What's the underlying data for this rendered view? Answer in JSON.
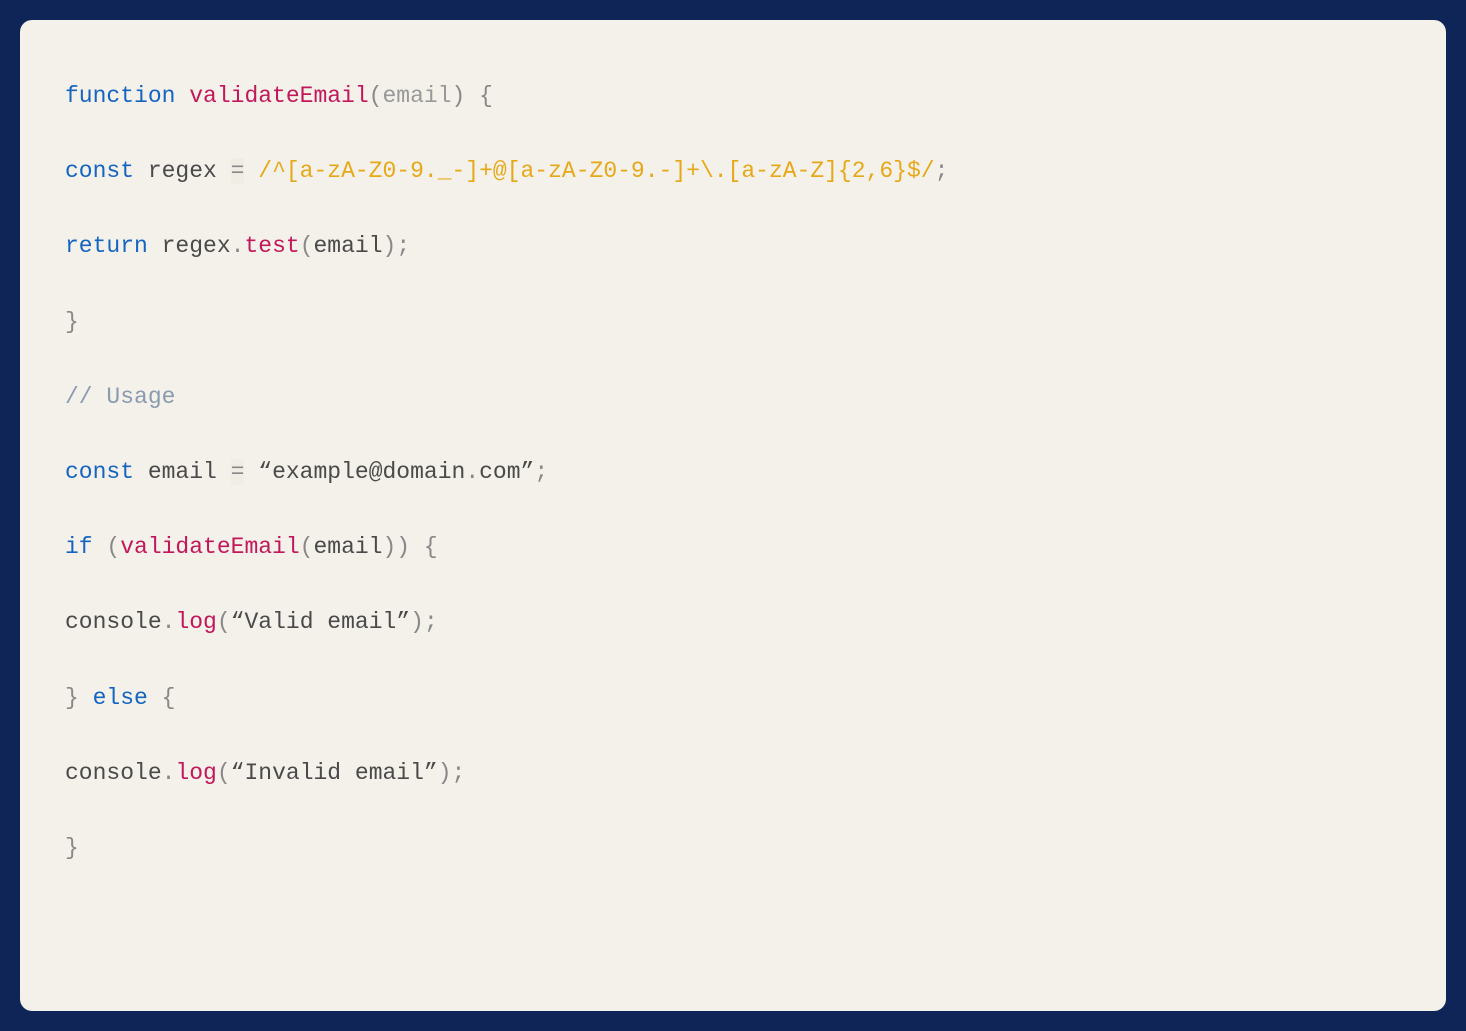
{
  "code": {
    "line1": {
      "function_kw": "function",
      "func_name": "validateEmail",
      "paren_open": "(",
      "param": "email",
      "paren_close": ")",
      "space_brace": " {",
      "brace": "{"
    },
    "line2": {
      "const_kw": "const",
      "var_name": " regex ",
      "equals": "=",
      "space": " ",
      "regex_literal": "/^[a-zA-Z0-9._-]+@[a-zA-Z0-9.-]+\\.[a-zA-Z]{2,6}$/",
      "semi": ";"
    },
    "line3": {
      "return_kw": "return",
      "var1": " regex",
      "dot": ".",
      "method": "test",
      "paren_open": "(",
      "arg": "email",
      "paren_close": ")",
      "semi": ";"
    },
    "line4": {
      "brace": "}"
    },
    "line5": {
      "comment": "// Usage"
    },
    "line6": {
      "const_kw": "const",
      "var_name": " email ",
      "equals": "=",
      "space": " ",
      "string_open": "“",
      "string_val": "example@domain",
      "dot": ".",
      "string_val2": "com",
      "string_close": "”",
      "semi": ";"
    },
    "line7": {
      "if_kw": "if",
      "space_paren": " (",
      "func_name": "validateEmail",
      "paren_open": "(",
      "arg": "email",
      "paren_close": ")",
      "paren_close2": ")",
      "space_brace": " {",
      "brace": "{"
    },
    "line8": {
      "console": "console",
      "dot": ".",
      "log": "log",
      "paren_open": "(",
      "string_open": "“",
      "string_val": "Valid email",
      "string_close": "”",
      "paren_close": ")",
      "semi": ";"
    },
    "line9": {
      "brace_close": "}",
      "space": " ",
      "else_kw": "else",
      "space2": " ",
      "brace_open": "{"
    },
    "line10": {
      "console": "console",
      "dot": ".",
      "log": "log",
      "paren_open": "(",
      "string_open": "“",
      "string_val": "Invalid email",
      "string_close": "”",
      "paren_close": ")",
      "semi": ";"
    },
    "line11": {
      "brace": "}"
    }
  }
}
